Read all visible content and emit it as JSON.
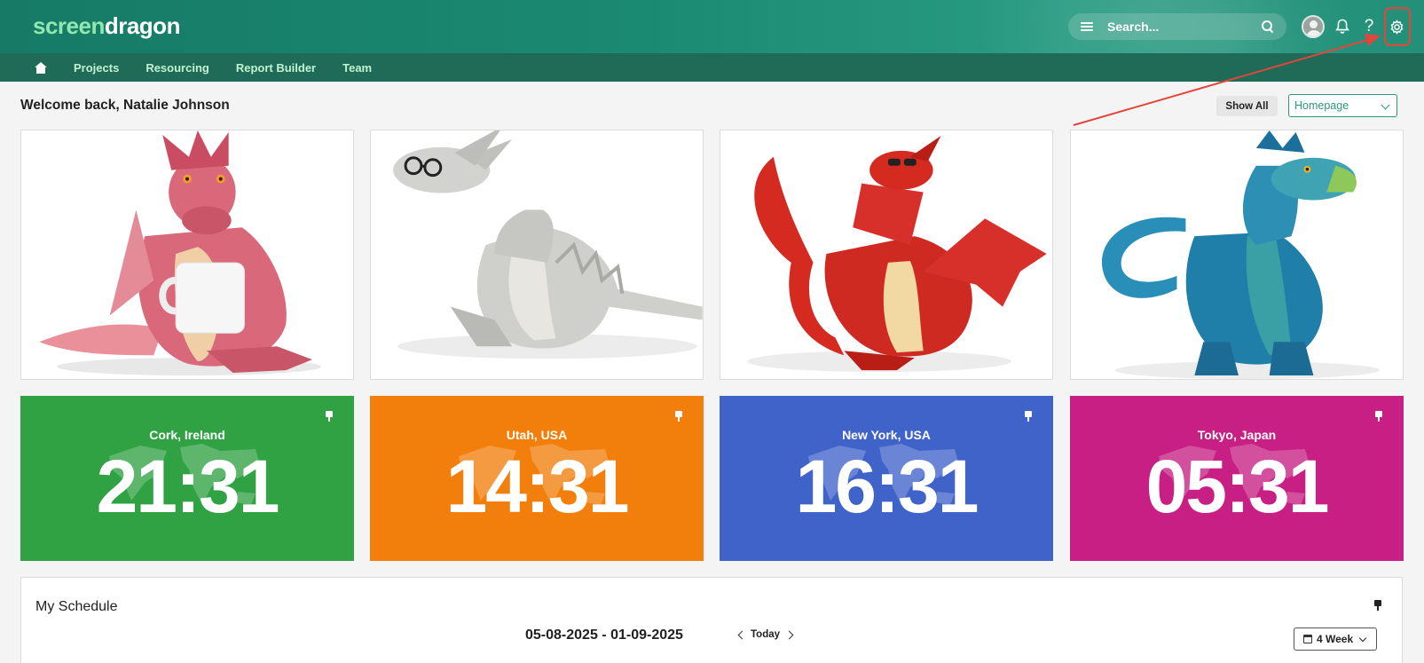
{
  "header": {
    "logo_part1": "screen",
    "logo_part2": "dragon",
    "search_placeholder": "Search...",
    "icons": [
      "menu-icon",
      "search-icon",
      "avatar",
      "bell-icon",
      "help-icon",
      "gear-icon"
    ]
  },
  "nav": {
    "items": [
      {
        "label": "Projects"
      },
      {
        "label": "Resourcing"
      },
      {
        "label": "Report Builder"
      },
      {
        "label": "Team"
      }
    ]
  },
  "page": {
    "welcome": "Welcome back, Natalie Johnson",
    "show_all": "Show All",
    "homepage_select": "Homepage"
  },
  "dragons": [
    {
      "name": "pink dragon with mug",
      "color": "#d9687a"
    },
    {
      "name": "white dragon with glasses",
      "color": "#c9c9c6"
    },
    {
      "name": "red dragon with wings",
      "color": "#d42a20"
    },
    {
      "name": "blue-green dragon",
      "color": "#2a8fb8"
    }
  ],
  "clocks": [
    {
      "city": "Cork, Ireland",
      "time": "21:31",
      "color": "#30a244"
    },
    {
      "city": "Utah, USA",
      "time": "14:31",
      "color": "#f27f0c"
    },
    {
      "city": "New York, USA",
      "time": "16:31",
      "color": "#4063c9"
    },
    {
      "city": "Tokyo, Japan",
      "time": "05:31",
      "color": "#c71f84"
    }
  ],
  "schedule": {
    "title": "My Schedule",
    "range": "05-08-2025 - 01-09-2025",
    "today": "Today",
    "view": "4 Week"
  },
  "colors": {
    "header": "#1b8a72",
    "nav": "#1f6b57",
    "accent": "#2a9a74",
    "annotation": "#e4453a"
  }
}
